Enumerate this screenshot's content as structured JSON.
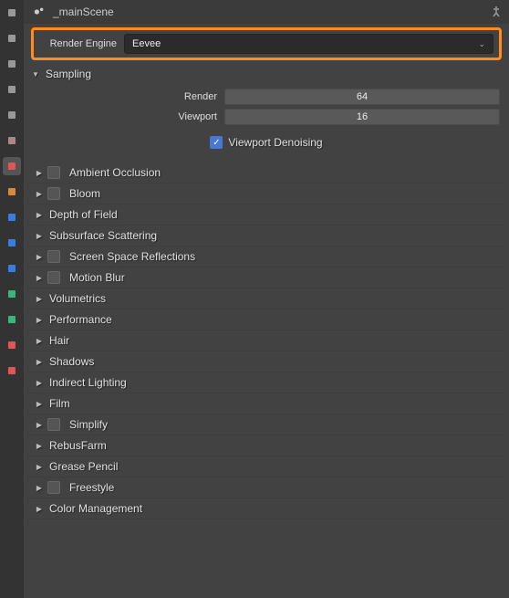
{
  "header": {
    "scene_name": "_mainScene"
  },
  "render_engine": {
    "label": "Render Engine",
    "value": "Eevee"
  },
  "sampling": {
    "title": "Sampling",
    "render_label": "Render",
    "render_value": "64",
    "viewport_label": "Viewport",
    "viewport_value": "16",
    "denoise_label": "Viewport Denoising",
    "denoise_checked": true
  },
  "panels": [
    {
      "label": "Ambient Occlusion",
      "has_checkbox": true
    },
    {
      "label": "Bloom",
      "has_checkbox": true
    },
    {
      "label": "Depth of Field",
      "has_checkbox": false
    },
    {
      "label": "Subsurface Scattering",
      "has_checkbox": false
    },
    {
      "label": "Screen Space Reflections",
      "has_checkbox": true
    },
    {
      "label": "Motion Blur",
      "has_checkbox": true
    },
    {
      "label": "Volumetrics",
      "has_checkbox": false
    },
    {
      "label": "Performance",
      "has_checkbox": false
    },
    {
      "label": "Hair",
      "has_checkbox": false
    },
    {
      "label": "Shadows",
      "has_checkbox": false
    },
    {
      "label": "Indirect Lighting",
      "has_checkbox": false
    },
    {
      "label": "Film",
      "has_checkbox": false
    },
    {
      "label": "Simplify",
      "has_checkbox": true
    },
    {
      "label": "RebusFarm",
      "has_checkbox": false
    },
    {
      "label": "Grease Pencil",
      "has_checkbox": false
    },
    {
      "label": "Freestyle",
      "has_checkbox": true
    },
    {
      "label": "Color Management",
      "has_checkbox": false
    }
  ],
  "vtabs": [
    {
      "name": "options-icon",
      "active": false
    },
    {
      "name": "tool-icon",
      "active": false
    },
    {
      "name": "render-icon",
      "active": false
    },
    {
      "name": "output-icon",
      "active": false
    },
    {
      "name": "viewlayer-icon",
      "active": false
    },
    {
      "name": "scene-icon",
      "active": false
    },
    {
      "name": "world-icon",
      "active": true
    },
    {
      "name": "object-icon",
      "active": false
    },
    {
      "name": "modifier-icon",
      "active": false
    },
    {
      "name": "particle-icon",
      "active": false
    },
    {
      "name": "physics-icon",
      "active": false
    },
    {
      "name": "constraint-icon",
      "active": false
    },
    {
      "name": "data-icon",
      "active": false
    },
    {
      "name": "material-icon",
      "active": false
    },
    {
      "name": "texture-icon",
      "active": false
    }
  ],
  "vtab_colors": [
    "#999",
    "#999",
    "#999",
    "#999",
    "#999",
    "#a88",
    "#e05555",
    "#d88838",
    "#3a7de0",
    "#3a7de0",
    "#3a7de0",
    "#38b878",
    "#38b878",
    "#e05555",
    "#e05555"
  ]
}
